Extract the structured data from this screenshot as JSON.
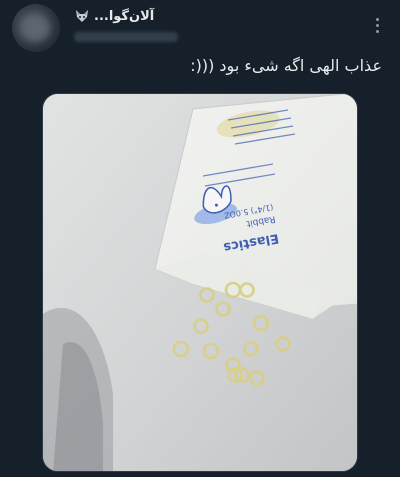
{
  "tweet": {
    "display_name": "آلان‌گوا...",
    "badge_icon": "fox-emoji-icon",
    "handle": "",
    "text": "عذاب الهی اگه شیء بود (((:",
    "more_icon": "more-vertical-icon"
  },
  "media": {
    "description_icon": "photo-image",
    "package_text": {
      "brand": "Elastics",
      "product": "Rabbit",
      "size": "(1/4\") 5.0OZ"
    }
  },
  "colors": {
    "background": "#15202b",
    "text_primary": "#e7e9ea",
    "text_secondary": "#8b98a5"
  }
}
